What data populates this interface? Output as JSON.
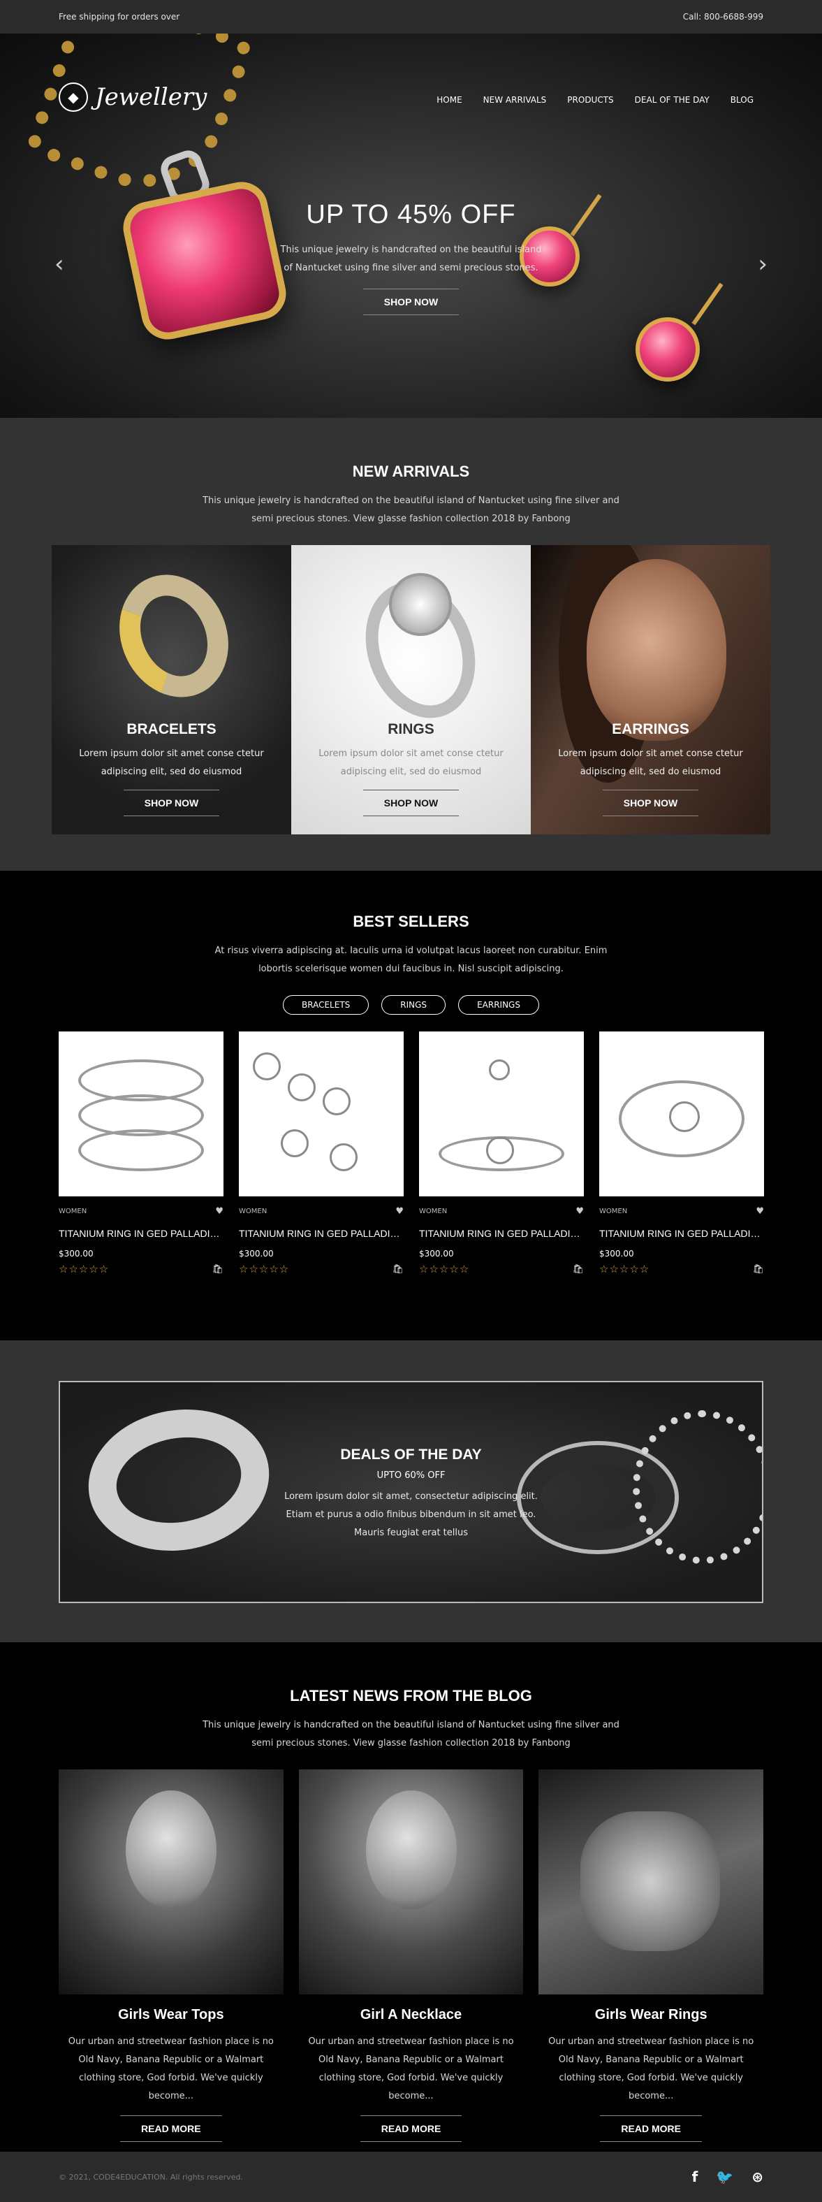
{
  "topbar": {
    "shipping": "Free shipping for orders over",
    "phone": "Call: 800-6688-999"
  },
  "brand": {
    "name": "Jewellery",
    "icon": "diamond-icon"
  },
  "nav": [
    "HOME",
    "NEW ARRIVALS",
    "PRODUCTS",
    "DEAL OF THE DAY",
    "BLOG"
  ],
  "hero": {
    "title": "UP TO 45% OFF",
    "text": "This unique jewelry is handcrafted on the beautiful island of Nantucket using fine silver and semi precious stones.",
    "button": "SHOP NOW",
    "prev": "‹",
    "next": "›"
  },
  "arrivals": {
    "title": "NEW ARRIVALS",
    "desc": "This unique jewelry is handcrafted on the beautiful island of Nantucket using fine silver and semi precious stones. View glasse fashion collection 2018 by Fanbong",
    "items": [
      {
        "title": "BRACELETS",
        "text": "Lorem ipsum dolor sit amet conse ctetur adipiscing elit, sed do eiusmod",
        "button": "SHOP NOW"
      },
      {
        "title": "RINGS",
        "text": "Lorem ipsum dolor sit amet conse ctetur adipiscing elit, sed do eiusmod",
        "button": "SHOP NOW"
      },
      {
        "title": "EARRINGS",
        "text": "Lorem ipsum dolor sit amet conse ctetur adipiscing elit, sed do eiusmod",
        "button": "SHOP NOW"
      }
    ]
  },
  "best": {
    "title": "BEST SELLERS",
    "desc": "At risus viverra adipiscing at. Iaculis urna id volutpat lacus laoreet non curabitur. Enim lobortis scelerisque women dui faucibus in. Nisl suscipit adipiscing.",
    "filters": [
      "BRACELETS",
      "RINGS",
      "EARRINGS"
    ],
    "products": [
      {
        "category": "WOMEN",
        "name": "TITANIUM RING IN GED PALLADIUMFINISH",
        "price": "$300.00",
        "stars": "☆☆☆☆☆"
      },
      {
        "category": "WOMEN",
        "name": "TITANIUM RING IN GED PALLADIUMFINISH",
        "price": "$300.00",
        "stars": "☆☆☆☆☆"
      },
      {
        "category": "WOMEN",
        "name": "TITANIUM RING IN GED PALLADIUMFINISH",
        "price": "$300.00",
        "stars": "☆☆☆☆☆"
      },
      {
        "category": "WOMEN",
        "name": "TITANIUM RING IN GED PALLADIUMFINISH",
        "price": "$300.00",
        "stars": "☆☆☆☆☆"
      }
    ],
    "heart": "♥",
    "cart": "🛍"
  },
  "deal": {
    "title": "DEALS OF THE DAY",
    "subtitle": "UPTO 60% OFF",
    "text": "Lorem ipsum dolor sit amet, consectetur adipiscing elit. Etiam et purus a odio finibus bibendum in sit amet leo. Mauris feugiat erat tellus"
  },
  "blog": {
    "title": "LATEST NEWS FROM THE BLOG",
    "desc": "This unique jewelry is handcrafted on the beautiful island of Nantucket using fine silver and semi precious stones. View glasse fashion collection 2018 by Fanbong",
    "posts": [
      {
        "title": "Girls Wear Tops",
        "text": "Our urban and streetwear fashion place is no Old Navy, Banana Republic or a Walmart clothing store, God forbid. We've quickly become...",
        "button": "READ MORE"
      },
      {
        "title": "Girl A Necklace",
        "text": "Our urban and streetwear fashion place is no Old Navy, Banana Republic or a Walmart clothing store, God forbid. We've quickly become...",
        "button": "READ MORE"
      },
      {
        "title": "Girls Wear Rings",
        "text": "Our urban and streetwear fashion place is no Old Navy, Banana Republic or a Walmart clothing store, God forbid. We've quickly become...",
        "button": "READ MORE"
      }
    ]
  },
  "footer": {
    "copyright": "© 2021, CODE4EDUCATION. All rights reserved.",
    "social": {
      "facebook": "f",
      "twitter": "🐦",
      "dribbble": "⊛"
    }
  }
}
